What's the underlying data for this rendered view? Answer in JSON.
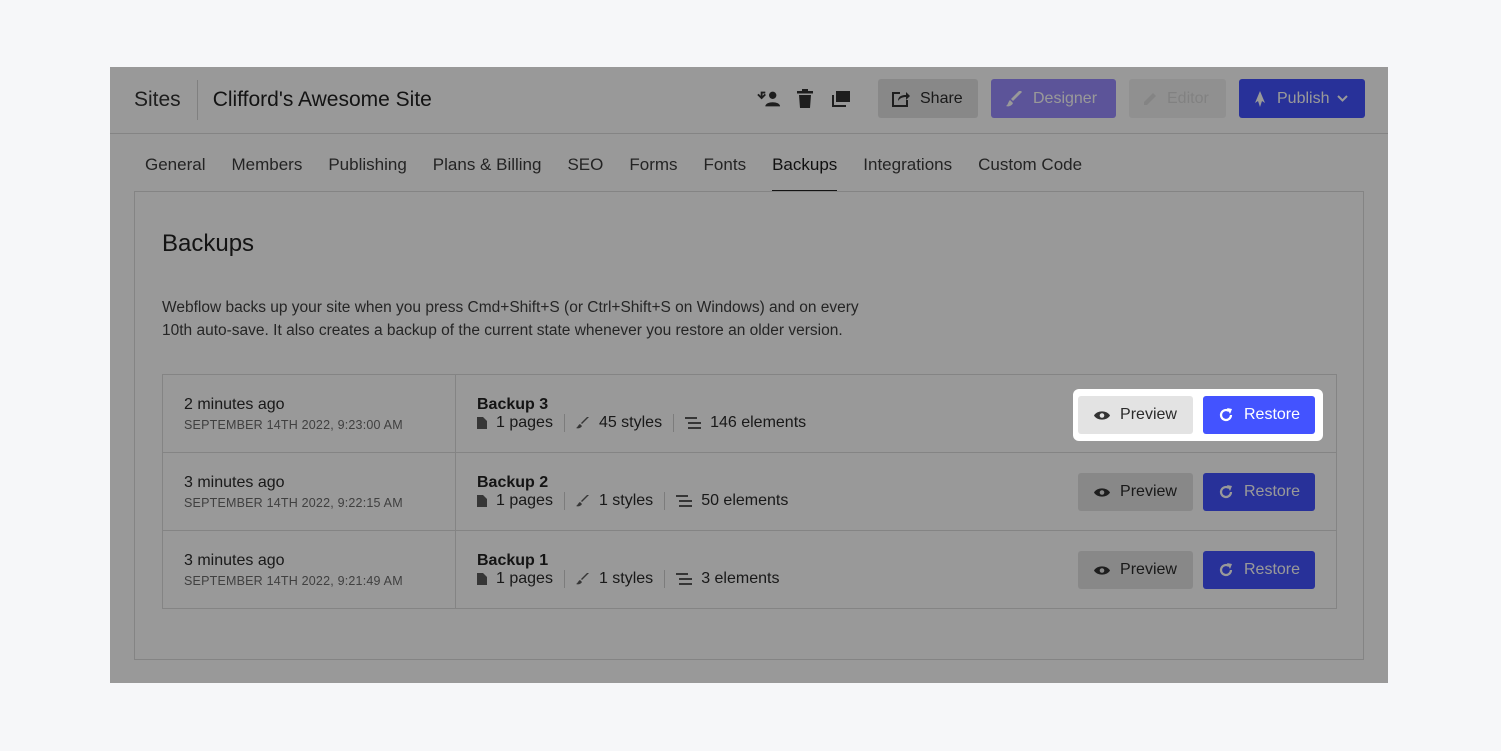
{
  "topbar": {
    "sites_label": "Sites",
    "site_title": "Clifford's Awesome Site",
    "icons": [
      "transfer-user-icon",
      "trash-icon",
      "duplicate-icon"
    ],
    "share_label": "Share",
    "designer_label": "Designer",
    "editor_label": "Editor",
    "publish_label": "Publish"
  },
  "tabs": [
    {
      "label": "General"
    },
    {
      "label": "Members"
    },
    {
      "label": "Publishing"
    },
    {
      "label": "Plans & Billing"
    },
    {
      "label": "SEO"
    },
    {
      "label": "Forms"
    },
    {
      "label": "Fonts"
    },
    {
      "label": "Backups",
      "active": true
    },
    {
      "label": "Integrations"
    },
    {
      "label": "Custom Code"
    }
  ],
  "panel": {
    "title": "Backups",
    "description": "Webflow backs up your site when you press Cmd+Shift+S (or Ctrl+Shift+S on Windows) and on every 10th auto-save. It also creates a backup of the current state whenever you restore an older version."
  },
  "backups": [
    {
      "relative": "2 minutes ago",
      "absolute": "SEPTEMBER 14TH 2022, 9:23:00 AM",
      "name": "Backup 3",
      "pages": "1 pages",
      "styles": "45 styles",
      "elements": "146 elements"
    },
    {
      "relative": "3 minutes ago",
      "absolute": "SEPTEMBER 14TH 2022, 9:22:15 AM",
      "name": "Backup 2",
      "pages": "1 pages",
      "styles": "1 styles",
      "elements": "50 elements"
    },
    {
      "relative": "3 minutes ago",
      "absolute": "SEPTEMBER 14TH 2022, 9:21:49 AM",
      "name": "Backup 1",
      "pages": "1 pages",
      "styles": "1 styles",
      "elements": "3 elements"
    }
  ],
  "actions": {
    "preview_label": "Preview",
    "restore_label": "Restore"
  },
  "colors": {
    "accent": "#4353ff",
    "designer": "#9a8cff",
    "overlay": "rgba(0,0,0,0.4)"
  }
}
